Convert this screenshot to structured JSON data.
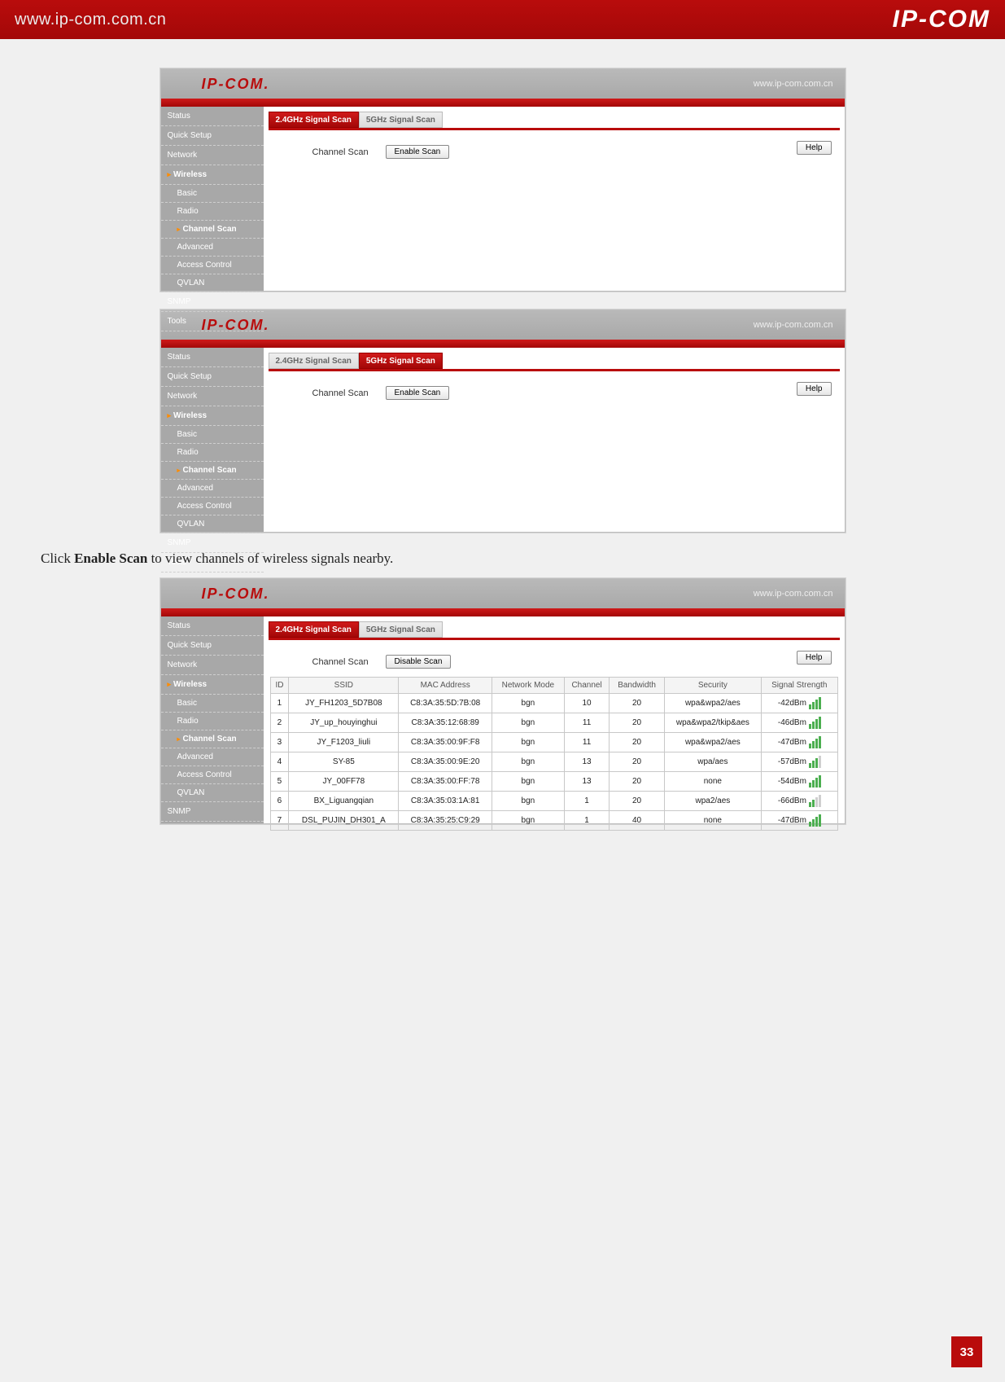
{
  "top": {
    "url": "www.ip-com.com.cn",
    "logo": "IP-COM"
  },
  "page_number": "33",
  "instruction": {
    "pre": "Click ",
    "bold": "Enable Scan",
    "post": " to view channels of wireless signals nearby."
  },
  "panel_head": {
    "logo": "IP-COM.",
    "url": "www.ip-com.com.cn"
  },
  "tabs": {
    "t24": "2.4GHz Signal Scan",
    "t5": "5GHz Signal Scan"
  },
  "scan": {
    "label": "Channel Scan",
    "enable": "Enable Scan",
    "disable": "Disable Scan",
    "help": "Help"
  },
  "sidebar": {
    "status": "Status",
    "quick": "Quick Setup",
    "network": "Network",
    "wireless": "Wireless",
    "basic": "Basic",
    "radio": "Radio",
    "chscan": "Channel Scan",
    "adv": "Advanced",
    "acc": "Access Control",
    "qvlan": "QVLAN",
    "snmp": "SNMP",
    "tools": "Tools"
  },
  "table": {
    "headers": {
      "id": "ID",
      "ssid": "SSID",
      "mac": "MAC Address",
      "mode": "Network Mode",
      "ch": "Channel",
      "bw": "Bandwidth",
      "sec": "Security",
      "sig": "Signal Strength"
    },
    "rows": [
      {
        "id": "1",
        "ssid": "JY_FH1203_5D7B08",
        "mac": "C8:3A:35:5D:7B:08",
        "mode": "bgn",
        "ch": "10",
        "bw": "20",
        "sec": "wpa&wpa2/aes",
        "sig": "-42dBm",
        "bars": 4
      },
      {
        "id": "2",
        "ssid": "JY_up_houyinghui",
        "mac": "C8:3A:35:12:68:89",
        "mode": "bgn",
        "ch": "11",
        "bw": "20",
        "sec": "wpa&wpa2/tkip&aes",
        "sig": "-46dBm",
        "bars": 4
      },
      {
        "id": "3",
        "ssid": "JY_F1203_liuli",
        "mac": "C8:3A:35:00:9F:F8",
        "mode": "bgn",
        "ch": "11",
        "bw": "20",
        "sec": "wpa&wpa2/aes",
        "sig": "-47dBm",
        "bars": 4
      },
      {
        "id": "4",
        "ssid": "SY-85",
        "mac": "C8:3A:35:00:9E:20",
        "mode": "bgn",
        "ch": "13",
        "bw": "20",
        "sec": "wpa/aes",
        "sig": "-57dBm",
        "bars": 3
      },
      {
        "id": "5",
        "ssid": "JY_00FF78",
        "mac": "C8:3A:35:00:FF:78",
        "mode": "bgn",
        "ch": "13",
        "bw": "20",
        "sec": "none",
        "sig": "-54dBm",
        "bars": 4
      },
      {
        "id": "6",
        "ssid": "BX_Liguangqian",
        "mac": "C8:3A:35:03:1A:81",
        "mode": "bgn",
        "ch": "1",
        "bw": "20",
        "sec": "wpa2/aes",
        "sig": "-66dBm",
        "bars": 2
      },
      {
        "id": "7",
        "ssid": "DSL_PUJIN_DH301_A",
        "mac": "C8:3A:35:25:C9:29",
        "mode": "bgn",
        "ch": "1",
        "bw": "40",
        "sec": "none",
        "sig": "-47dBm",
        "bars": 4
      }
    ]
  }
}
